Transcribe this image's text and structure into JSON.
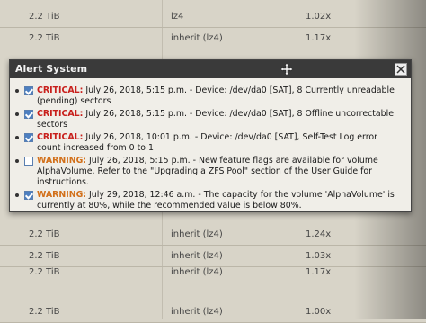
{
  "background_table": {
    "rows": [
      {
        "size": "2.2 TiB",
        "compression": "lz4",
        "ratio": "1.02x"
      },
      {
        "size": "2.2 TiB",
        "compression": "inherit (lz4)",
        "ratio": "1.17x"
      },
      {
        "size": "",
        "compression": "",
        "ratio": ""
      },
      {
        "size": "2.2 TiB",
        "compression": "inherit (lz4)",
        "ratio": "1.24x"
      },
      {
        "size": "2.2 TiB",
        "compression": "inherit (lz4)",
        "ratio": "1.03x"
      },
      {
        "size": "2.2 TiB",
        "compression": "inherit (lz4)",
        "ratio": "1.17x"
      },
      {
        "size": "2.2 TiB",
        "compression": "inherit (lz4)",
        "ratio": "1.00x"
      }
    ]
  },
  "dialog": {
    "title": "Alert System",
    "alerts": [
      {
        "checked": true,
        "level": "CRITICAL:",
        "message": " July 26, 2018, 5:15 p.m. - Device: /dev/da0 [SAT], 8 Currently unreadable (pending) sectors"
      },
      {
        "checked": true,
        "level": "CRITICAL:",
        "message": " July 26, 2018, 5:15 p.m. - Device: /dev/da0 [SAT], 8 Offline uncorrectable sectors"
      },
      {
        "checked": true,
        "level": "CRITICAL:",
        "message": " July 26, 2018, 10:01 p.m. - Device: /dev/da0 [SAT], Self-Test Log error count increased from 0 to 1"
      },
      {
        "checked": false,
        "level": "WARNING:",
        "message": " July 26, 2018, 5:15 p.m. - New feature flags are available for volume AlphaVolume. Refer to the \"Upgrading a ZFS Pool\" section of the User Guide for instructions."
      },
      {
        "checked": true,
        "level": "WARNING:",
        "message": " July 29, 2018, 12:46 a.m. - The capacity for the volume 'AlphaVolume' is currently at 80%, while the recommended value is below 80%."
      }
    ]
  },
  "icons": {
    "move": "move-icon",
    "close": "close-icon"
  },
  "colors": {
    "critical": "#c8201c",
    "warning": "#d2701a",
    "title_bar": "#3a3a3a",
    "checkbox": "#4d7fc0"
  }
}
